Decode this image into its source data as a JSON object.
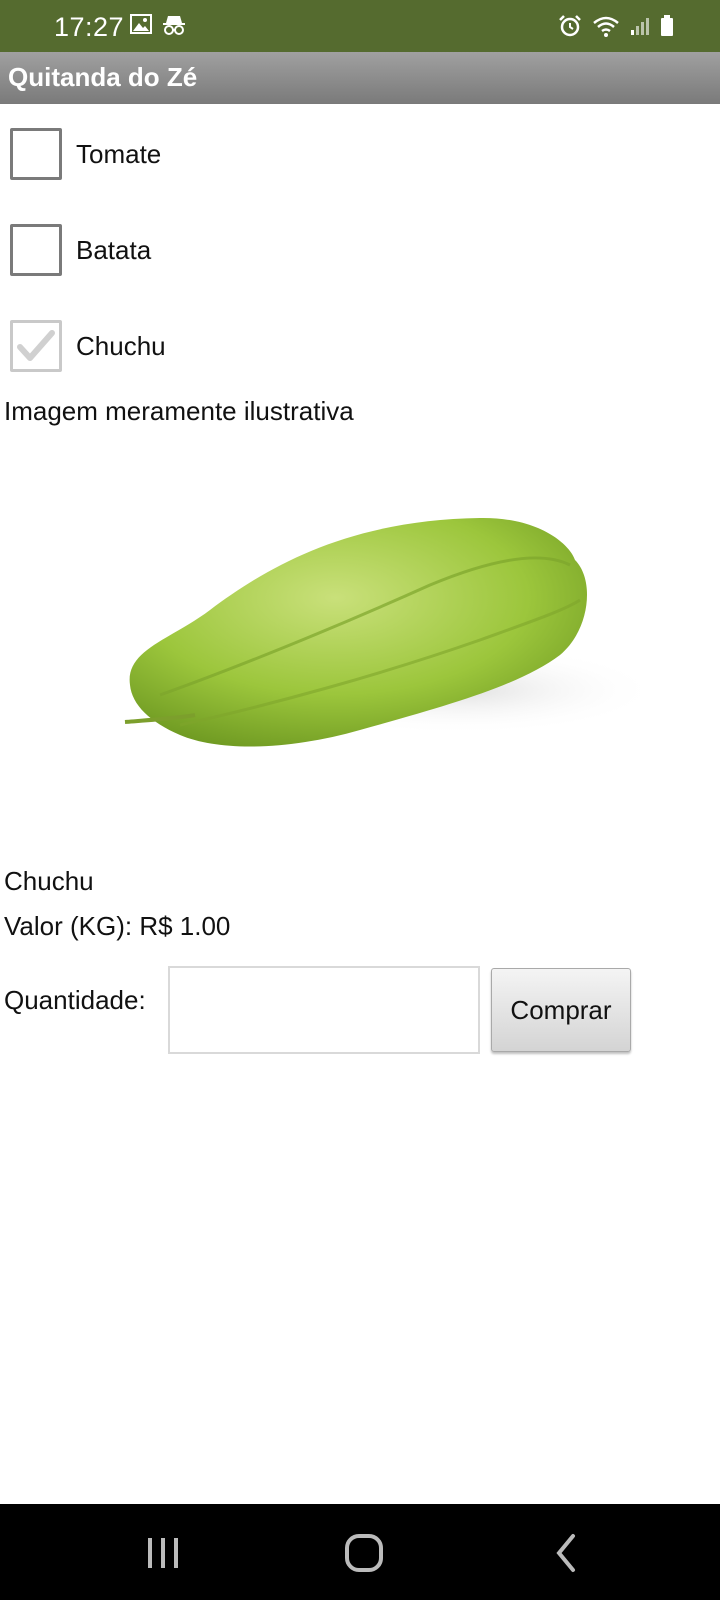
{
  "status_bar": {
    "time": "17:27",
    "left_icons": [
      "image-icon",
      "incognito-icon"
    ],
    "right_icons": [
      "alarm-icon",
      "wifi-icon",
      "signal-icon",
      "battery-icon"
    ],
    "background": "#556b2f"
  },
  "app": {
    "title": "Quitanda do Zé"
  },
  "options": [
    {
      "label": "Tomate",
      "checked": false
    },
    {
      "label": "Batata",
      "checked": false
    },
    {
      "label": "Chuchu",
      "checked": true
    }
  ],
  "caption": "Imagem meramente ilustrativa",
  "product": {
    "image": "chayote-image",
    "name": "Chuchu",
    "price_text": "Valor (KG): R$ 1.00"
  },
  "quantity": {
    "label": "Quantidade:",
    "value": "",
    "placeholder": ""
  },
  "buy_button": {
    "label": "Comprar"
  },
  "nav_bar": {
    "buttons": [
      "recent-apps-icon",
      "home-icon",
      "back-icon"
    ]
  }
}
